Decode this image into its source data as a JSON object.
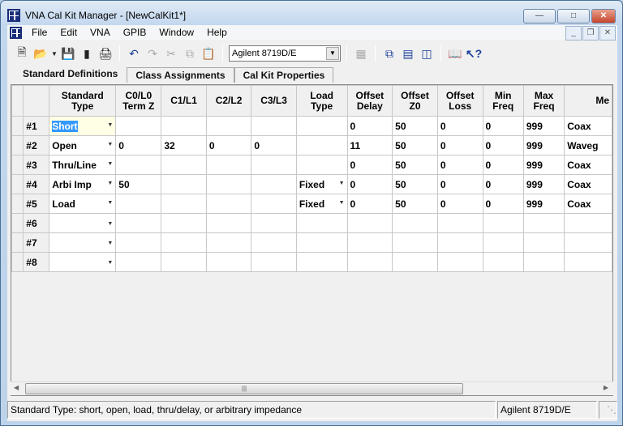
{
  "window": {
    "title": "VNA Cal Kit Manager - [NewCalKit1*]"
  },
  "menu": [
    "File",
    "Edit",
    "VNA",
    "GPIB",
    "Window",
    "Help"
  ],
  "toolbar": {
    "vna_select": "Agilent 8719D/E"
  },
  "tabs": [
    "Standard Definitions",
    "Class Assignments",
    "Cal Kit Properties"
  ],
  "grid": {
    "columns": [
      "Standard\nType",
      "C0/L0\nTerm Z",
      "C1/L1",
      "C2/L2",
      "C3/L3",
      "Load\nType",
      "Offset\nDelay",
      "Offset\nZ0",
      "Offset\nLoss",
      "Min\nFreq",
      "Max\nFreq",
      "Me"
    ],
    "rows": [
      {
        "id": "#1",
        "cells": [
          "Short",
          "",
          "",
          "",
          "",
          "",
          "0",
          "50",
          "0",
          "0",
          "999",
          "Coax"
        ]
      },
      {
        "id": "#2",
        "cells": [
          "Open",
          "0",
          "32",
          "0",
          "0",
          "",
          "11",
          "50",
          "0",
          "0",
          "999",
          "Waveg"
        ]
      },
      {
        "id": "#3",
        "cells": [
          "Thru/Line",
          "",
          "",
          "",
          "",
          "",
          "0",
          "50",
          "0",
          "0",
          "999",
          "Coax"
        ]
      },
      {
        "id": "#4",
        "cells": [
          "Arbi Imp",
          "50",
          "",
          "",
          "",
          "Fixed",
          "0",
          "50",
          "0",
          "0",
          "999",
          "Coax"
        ]
      },
      {
        "id": "#5",
        "cells": [
          "Load",
          "",
          "",
          "",
          "",
          "Fixed",
          "0",
          "50",
          "0",
          "0",
          "999",
          "Coax"
        ]
      },
      {
        "id": "#6",
        "cells": [
          "",
          "",
          "",
          "",
          "",
          "",
          "",
          "",
          "",
          "",
          "",
          ""
        ]
      },
      {
        "id": "#7",
        "cells": [
          "",
          "",
          "",
          "",
          "",
          "",
          "",
          "",
          "",
          "",
          "",
          ""
        ]
      },
      {
        "id": "#8",
        "cells": [
          "",
          "",
          "",
          "",
          "",
          "",
          "",
          "",
          "",
          "",
          "",
          ""
        ]
      }
    ]
  },
  "status": {
    "message": "Standard Type: short, open, load, thru/delay, or arbitrary impedance",
    "instrument": "Agilent 8719D/E"
  }
}
